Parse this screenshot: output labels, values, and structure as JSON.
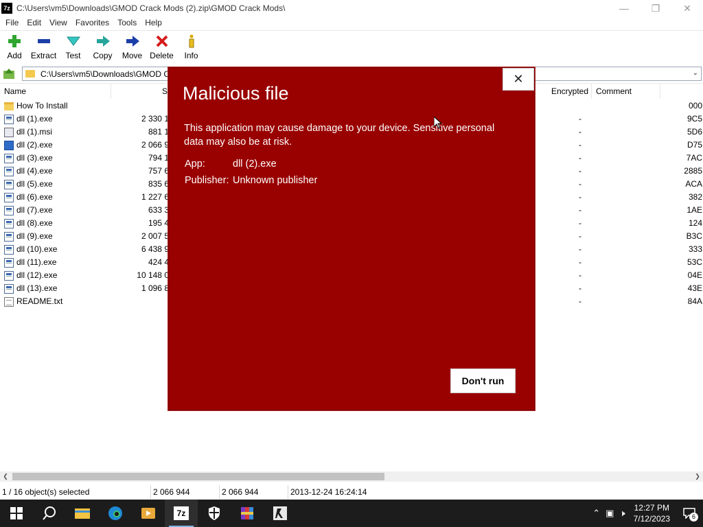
{
  "window": {
    "title": "C:\\Users\\vm5\\Downloads\\GMOD Crack Mods (2).zip\\GMOD Crack Mods\\",
    "app_icon": "7z"
  },
  "menu": [
    "File",
    "Edit",
    "View",
    "Favorites",
    "Tools",
    "Help"
  ],
  "toolbar": [
    {
      "label": "Add",
      "icon": "plus-icon"
    },
    {
      "label": "Extract",
      "icon": "minus-icon"
    },
    {
      "label": "Test",
      "icon": "check-down-icon"
    },
    {
      "label": "Copy",
      "icon": "copy-arrow-icon"
    },
    {
      "label": "Move",
      "icon": "move-arrow-icon"
    },
    {
      "label": "Delete",
      "icon": "x-icon"
    },
    {
      "label": "Info",
      "icon": "info-icon"
    }
  ],
  "address": {
    "path": "C:\\Users\\vm5\\Downloads\\GMOD C"
  },
  "columns": {
    "name": "Name",
    "size": "Si",
    "encrypted": "Encrypted",
    "comment": "Comment"
  },
  "files": [
    {
      "name": "How To Install",
      "type": "folder",
      "size": "",
      "enc": "",
      "crc": "000"
    },
    {
      "name": "dll (1).exe",
      "type": "exe",
      "size": "2 330 1",
      "enc": "-",
      "crc": "9C5"
    },
    {
      "name": "dll (1).msi",
      "type": "msi",
      "size": "881 1",
      "enc": "-",
      "crc": "5D6"
    },
    {
      "name": "dll (2).exe",
      "type": "exe-blue",
      "size": "2 066 9",
      "enc": "-",
      "crc": "D75"
    },
    {
      "name": "dll (3).exe",
      "type": "exe",
      "size": "794 1",
      "enc": "-",
      "crc": "7AC"
    },
    {
      "name": "dll (4).exe",
      "type": "exe",
      "size": "757 6",
      "enc": "-",
      "crc": "2885"
    },
    {
      "name": "dll (5).exe",
      "type": "exe",
      "size": "835 6",
      "enc": "-",
      "crc": "ACA"
    },
    {
      "name": "dll (6).exe",
      "type": "exe",
      "size": "1 227 6",
      "enc": "-",
      "crc": "382"
    },
    {
      "name": "dll (7).exe",
      "type": "exe",
      "size": "633 3",
      "enc": "-",
      "crc": "1AE"
    },
    {
      "name": "dll (8).exe",
      "type": "exe",
      "size": "195 4",
      "enc": "-",
      "crc": "124"
    },
    {
      "name": "dll (9).exe",
      "type": "exe",
      "size": "2 007 5",
      "enc": "-",
      "crc": "B3C"
    },
    {
      "name": "dll (10).exe",
      "type": "exe",
      "size": "6 438 9",
      "enc": "-",
      "crc": "333"
    },
    {
      "name": "dll (11).exe",
      "type": "exe",
      "size": "424 4",
      "enc": "-",
      "crc": "53C"
    },
    {
      "name": "dll (12).exe",
      "type": "exe",
      "size": "10 148 0",
      "enc": "-",
      "crc": "04E"
    },
    {
      "name": "dll (13).exe",
      "type": "exe",
      "size": "1 096 8",
      "enc": "-",
      "crc": "43E"
    },
    {
      "name": "README.txt",
      "type": "txt",
      "size": "",
      "enc": "-",
      "crc": "84A"
    }
  ],
  "status": {
    "selection": "1 / 16 object(s) selected",
    "size": "2 066 944",
    "packed": "2 066 944",
    "modified": "2013-12-24 16:24:14"
  },
  "dialog": {
    "title": "Malicious file",
    "message": "This application may cause damage to your device. Sensitive personal data may also be at risk.",
    "app_key": "App:",
    "app_value": "dll (2).exe",
    "publisher_key": "Publisher:",
    "publisher_value": "Unknown publisher",
    "button": "Don't run",
    "bg_color": "#990000"
  },
  "taskbar": {
    "time": "12:27 PM",
    "date": "7/12/2023",
    "notification_count": "6"
  }
}
